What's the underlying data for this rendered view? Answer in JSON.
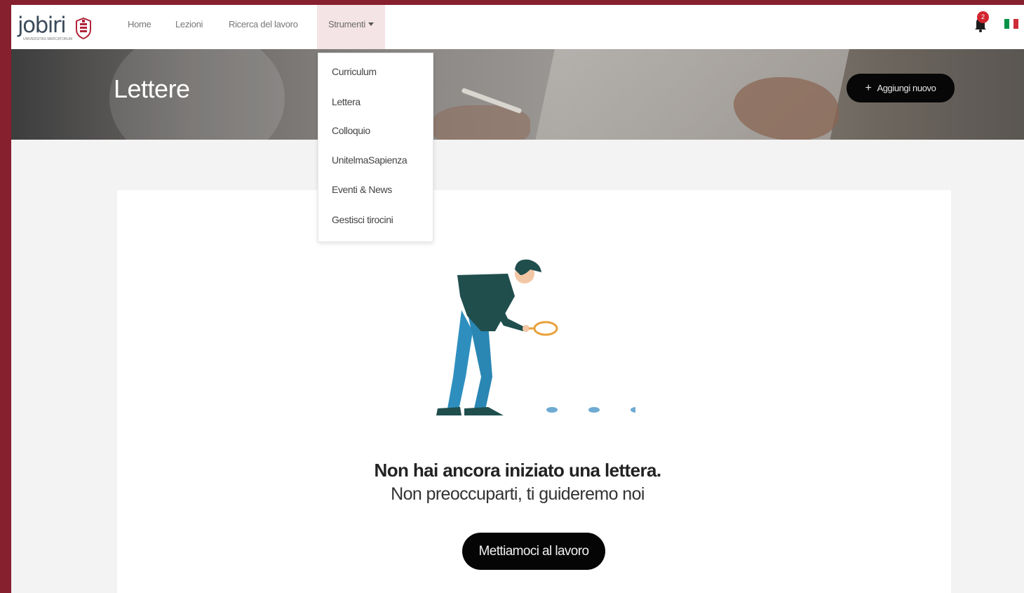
{
  "brand": {
    "logo_text": "jobiri",
    "logo_sub": "UNIVERSITAS MERCATORUM"
  },
  "nav": {
    "items": [
      {
        "label": "Home"
      },
      {
        "label": "Lezioni"
      },
      {
        "label": "Ricerca del lavoro"
      },
      {
        "label": "Strumenti"
      }
    ],
    "active": "Strumenti"
  },
  "notifications": {
    "count": "2",
    "icon": "bell-icon"
  },
  "language": {
    "flag": "italy-flag-icon",
    "colors": [
      "#009246",
      "#ffffff",
      "#ce2b37"
    ]
  },
  "hero": {
    "title": "Lettere",
    "add_button": "Aggiungi nuovo"
  },
  "dropdown": {
    "items": [
      "Curriculum",
      "Lettera",
      "Colloquio",
      "UnitelmaSapienza",
      "Eventi & News",
      "Gestisci tirocini"
    ]
  },
  "empty_state": {
    "line1": "Non hai ancora iniziato una lettera.",
    "line2": "Non preoccuparti, ti guideremo noi",
    "cta": "Mettiamoci al lavoro"
  },
  "colors": {
    "frame": "#861f2e",
    "accent_dark": "#050505",
    "figure_blue": "#2e8fbf",
    "figure_dark": "#1f4e4d",
    "lens": "#e9a13a"
  }
}
